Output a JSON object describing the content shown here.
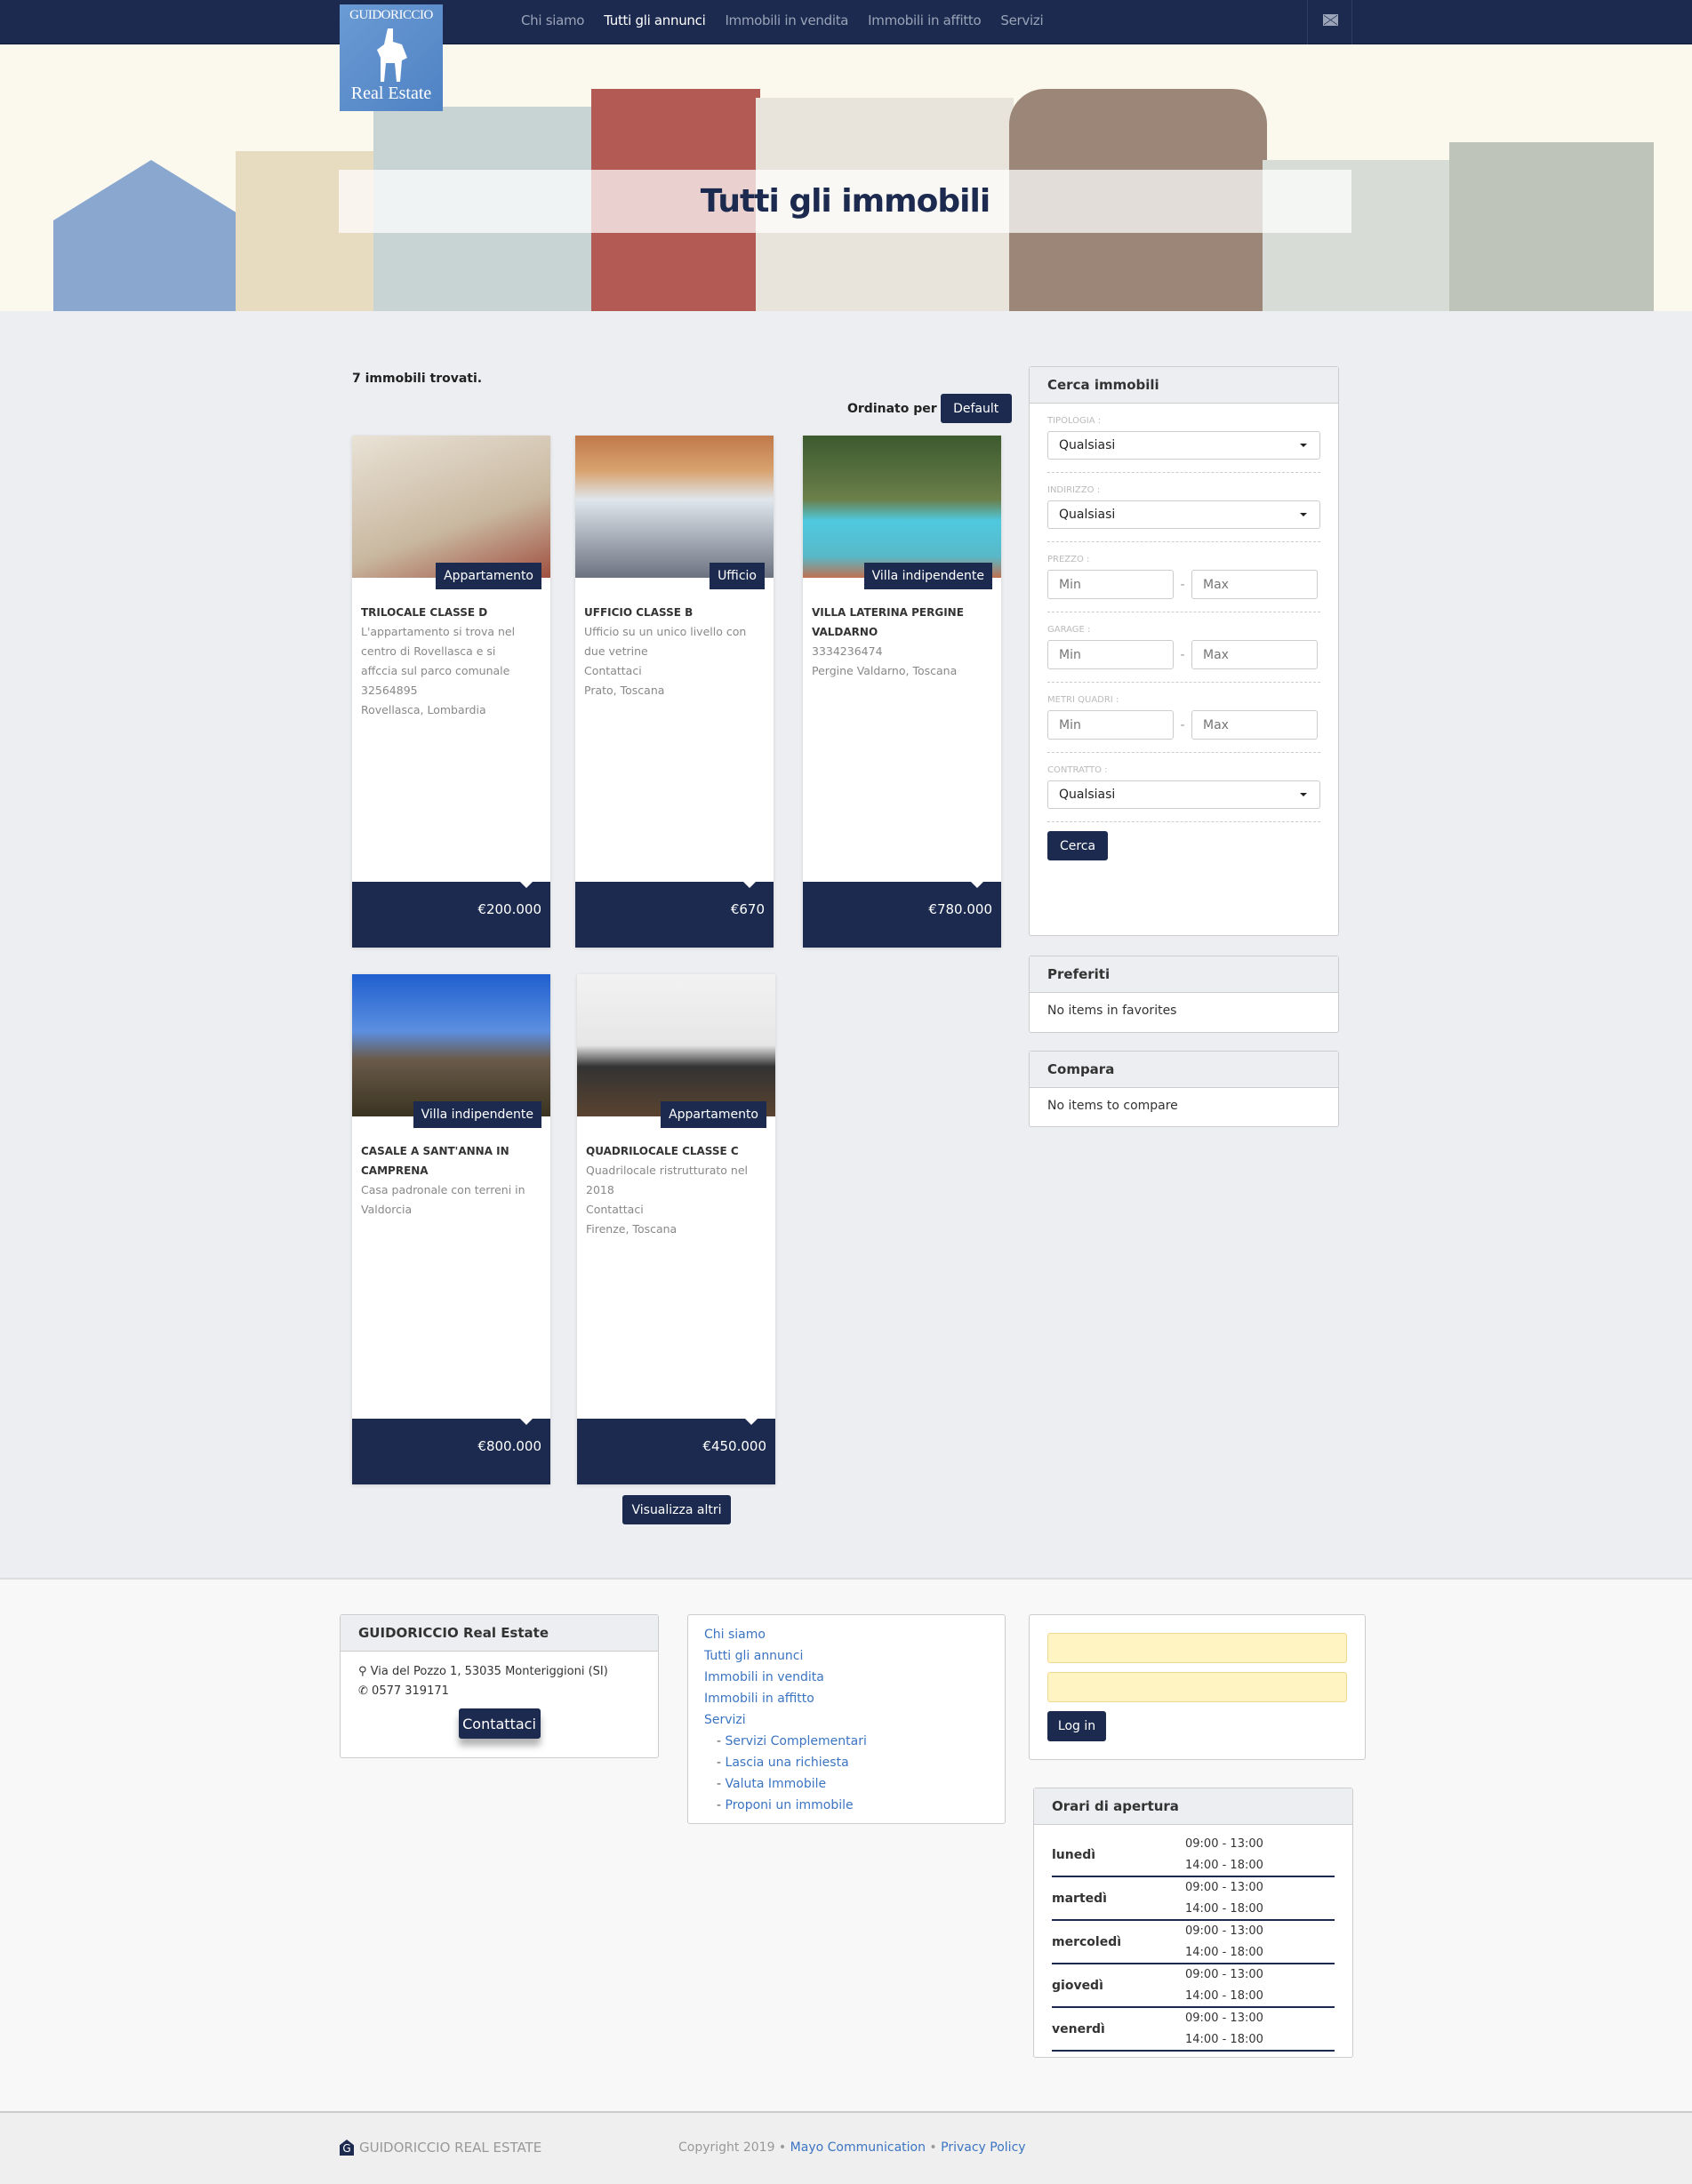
{
  "nav": {
    "logo_top": "GUIDORICCIO",
    "logo_bottom": "Real Estate",
    "items": [
      "Chi siamo",
      "Tutti gli annunci",
      "Immobili in vendita",
      "Immobili in affitto",
      "Servizi"
    ],
    "active": 1,
    "mail_icon": "envelope-icon"
  },
  "hero": {
    "title": "Tutti gli immobili"
  },
  "listing": {
    "count_text": "7 immobili trovati.",
    "sort_label": "Ordinato per",
    "sort_value": "Default",
    "more_label": "Visualizza altri",
    "cards": [
      {
        "badge": "Appartamento",
        "title": "TRILOCALE CLASSE D",
        "lines": [
          "L'appartamento si trova nel",
          "centro di Rovellasca e si",
          "affccia sul parco comunale",
          "32564895",
          "Rovellasca, Lombardia"
        ],
        "price": "€200.000"
      },
      {
        "badge": "Ufficio",
        "title": "UFFICIO CLASSE B",
        "lines": [
          "Ufficio su un unico livello con",
          "due vetrine",
          "Contattaci",
          "Prato, Toscana"
        ],
        "price": "€670"
      },
      {
        "badge": "Villa indipendente",
        "title": "VILLA LATERINA PERGINE VALDARNO",
        "lines": [
          "3334236474",
          "Pergine Valdarno, Toscana"
        ],
        "price": "€780.000"
      },
      {
        "badge": "Villa indipendente",
        "title": "CASALE A SANT'ANNA IN CAMPRENA",
        "lines": [
          "Casa padronale con terreni in",
          "Valdorcia"
        ],
        "price": "€800.000"
      },
      {
        "badge": "Appartamento",
        "title": "QUADRILOCALE CLASSE C",
        "lines": [
          "Quadrilocale ristrutturato nel",
          "2018",
          "Contattaci",
          "Firenze, Toscana"
        ],
        "price": "€450.000"
      }
    ]
  },
  "search": {
    "title": "Cerca immobili",
    "tipologia_label": "TIPOLOGIA :",
    "tipologia_value": "Qualsiasi",
    "indirizzo_label": "INDIRIZZO :",
    "indirizzo_value": "Qualsiasi",
    "prezzo_label": "PREZZO :",
    "garage_label": "GARAGE :",
    "mq_label": "METRI QUADRI :",
    "min_placeholder": "Min",
    "max_placeholder": "Max",
    "contratto_label": "CONTRATTO :",
    "contratto_value": "Qualsiasi",
    "button": "Cerca"
  },
  "favorites": {
    "title": "Preferiti",
    "empty": "No items in favorites"
  },
  "compare": {
    "title": "Compara",
    "empty": "No items to compare"
  },
  "footer": {
    "company": {
      "title": "GUIDORICCIO Real Estate",
      "address": "Via del Pozzo 1, 53035 Monteriggioni (SI)",
      "phone": "0577 319171",
      "button": "Contattaci"
    },
    "links": [
      "Chi siamo",
      "Tutti gli annunci",
      "Immobili in vendita",
      "Immobili in affitto",
      "Servizi"
    ],
    "sublinks": [
      "Servizi Complementari",
      "Lascia una richiesta",
      "Valuta Immobile",
      "Proponi un immobile"
    ],
    "login_button": "Log in",
    "hours": {
      "title": "Orari di apertura",
      "days": [
        {
          "day": "lunedì",
          "am": "09:00 - 13:00",
          "pm": "14:00 - 18:00"
        },
        {
          "day": "martedì",
          "am": "09:00 - 13:00",
          "pm": "14:00 - 18:00"
        },
        {
          "day": "mercoledì",
          "am": "09:00 - 13:00",
          "pm": "14:00 - 18:00"
        },
        {
          "day": "giovedì",
          "am": "09:00 - 13:00",
          "pm": "14:00 - 18:00"
        },
        {
          "day": "venerdì",
          "am": "09:00 - 13:00",
          "pm": "14:00 - 18:00"
        }
      ]
    }
  },
  "bottom": {
    "brand": "GUIDORICCIO REAL ESTATE",
    "copyright": "Copyright 2019 •",
    "link1": "Mayo Communication",
    "sep": "•",
    "link2": "Privacy Policy"
  },
  "colors": {
    "primary": "#1b2a4e",
    "link": "#3b74c2",
    "background": "#eceef1"
  }
}
